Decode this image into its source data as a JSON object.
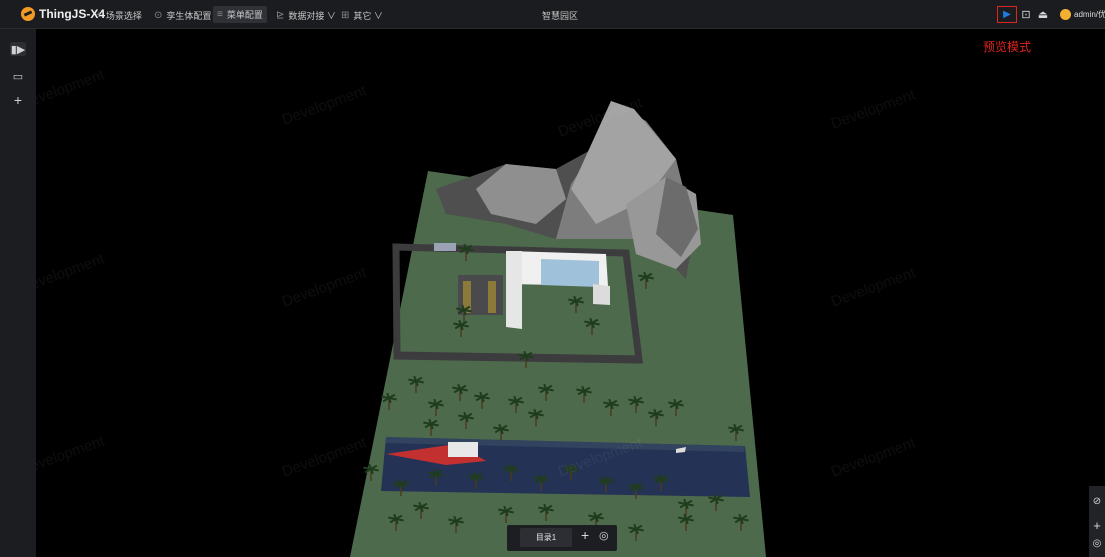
{
  "topbar": {
    "brand": "ThingJS-X4",
    "menu": [
      {
        "icon": "+",
        "label": "场景选择"
      },
      {
        "icon": "⊙",
        "label": "孪生体配置"
      },
      {
        "icon": "≡",
        "label": "菜单配置"
      },
      {
        "icon": "⊵",
        "label": "数据对接 ∨"
      },
      {
        "icon": "⊞",
        "label": "其它 ∨"
      }
    ],
    "title": "智慧园区",
    "user": "admin/优易",
    "icons": {
      "preview": "▶",
      "save": "⊡",
      "publish": "⏏"
    }
  },
  "preview_hint": "预览模式",
  "sidebar": {
    "icons": [
      "▮▶",
      "▭",
      "+"
    ]
  },
  "watermark": "Development",
  "bottom_bar": {
    "tab_label": "目录1",
    "add": "+",
    "target": "◎"
  },
  "right_panel": {
    "icons": [
      "⊘",
      "+",
      "◎"
    ]
  },
  "colors": {
    "accent": "#1f7ce0",
    "highlight": "#e0241e",
    "logo": "#f29a24",
    "grass": "#4e6a4c",
    "water": "#243255"
  }
}
